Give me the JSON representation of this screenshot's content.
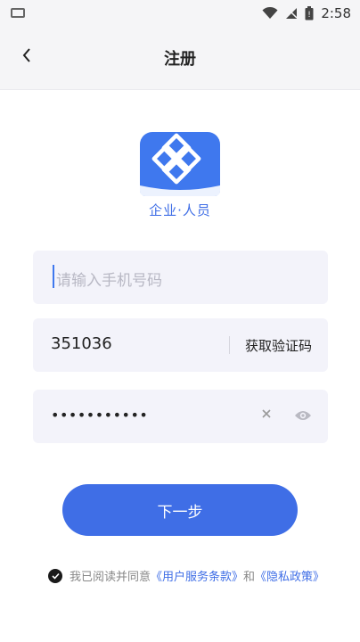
{
  "status": {
    "time": "2:58"
  },
  "nav": {
    "title": "注册",
    "back_icon": "chevron-left-icon"
  },
  "logo": {
    "caption": "企业·人员",
    "color": "#3f78ee"
  },
  "phone_field": {
    "placeholder": "请输入手机号码",
    "value": ""
  },
  "code_field": {
    "value": "351036",
    "button_label": "获取验证码"
  },
  "password_field": {
    "value": "•••••••••••",
    "clear_icon": "close-icon",
    "toggle_icon": "eye-icon"
  },
  "next_button": {
    "label": "下一步"
  },
  "agreement": {
    "prefix": "我已阅读并同意",
    "terms_link": "《用户服务条款》",
    "conjunction": "和",
    "privacy_link": "《隐私政策》",
    "checked": true
  },
  "colors": {
    "accent": "#3f6ee6",
    "field_bg": "#f3f3fa",
    "header_bg": "#f5f5f7"
  }
}
